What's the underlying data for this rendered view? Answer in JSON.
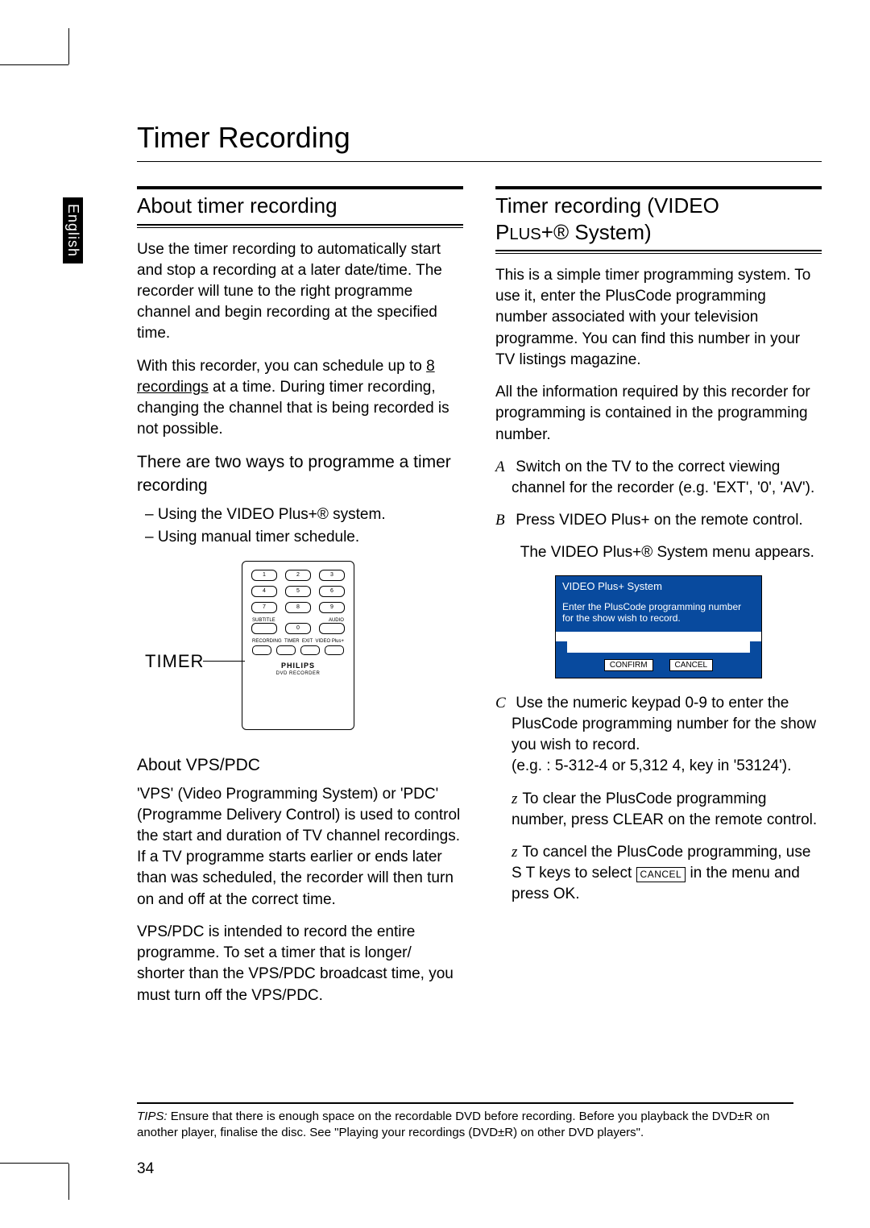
{
  "language_tab": "English",
  "page_title": "Timer Recording",
  "left": {
    "h_about": "About timer recording",
    "p1": "Use the timer recording to automatically start and stop a recording at a later date/time. The recorder will tune to the right programme channel and begin recording at the specified time.",
    "p2a": "With this recorder, you can schedule up to ",
    "p2b_underline": "8 recordings",
    "p2c": " at a time. During timer recording, changing the channel that is being recorded is not possible.",
    "sub_two_ways": "There are two ways to programme a timer recording",
    "way1": "Using the VIDEO Plus+® system.",
    "way2": "Using manual timer schedule.",
    "timer_label": "TIMER",
    "sub_vps": "About  VPS/PDC",
    "vps_p1": "'VPS' (Video Programming System) or 'PDC' (Programme Delivery Control) is used to control the start and duration of TV channel recordings.  If a TV programme starts earlier or ends later than was scheduled, the recorder will then turn on and off at the correct time.",
    "vps_p2": "VPS/PDC is intended to record the entire programme. To set a timer that is longer/ shorter than the VPS/PDC broadcast time, you must turn off the VPS/PDC.",
    "remote": {
      "keys": [
        "1",
        "2",
        "3",
        "4",
        "5",
        "6",
        "7",
        "8",
        "9"
      ],
      "mid_label_subtitle": "SUBTITLE",
      "mid_key": "0",
      "mid_label_audio": "AUDIO",
      "row_labels": [
        "RECORDING",
        "TIMER",
        "EXIT",
        "VIDEO Plus+"
      ],
      "brand": "PHILIPS",
      "sub": "DVD RECORDER"
    }
  },
  "right": {
    "h_timer": "Timer recording (VIDEO PLUS+® System)",
    "p1": "This is a simple timer programming system. To use it, enter the PlusCode programming number associated with your television programme. You can find this number in your TV listings magazine.",
    "p2": "All the information required by this recorder for programming is contained in the programming number.",
    "stepA": "Switch on the TV to the correct viewing channel for the recorder (e.g. 'EXT', '0', 'AV').",
    "stepB": "Press VIDEO Plus+ on the remote control.",
    "stepB_note": "The VIDEO Plus+® System menu appears.",
    "menu": {
      "title": "VIDEO Plus+ System",
      "body": "Enter the PlusCode programming number for the show wish to record.",
      "confirm": "CONFIRM",
      "cancel": "CANCEL"
    },
    "stepC_a": "Use the ",
    "stepC_keypad": "numeric keypad 0-9",
    "stepC_b": " to enter the PlusCode programming number for the show you wish to record.",
    "stepC_eg": "(e.g. : 5-312-4 or 5,312 4, key in '53124').",
    "noteClear_a": "To clear the PlusCode programming number, press ",
    "noteClear_b": "CLEAR",
    "noteClear_c": " on the remote control.",
    "noteCancel_a": "To cancel the PlusCode programming, use  S T  keys to select ",
    "noteCancel_box": "CANCEL",
    "noteCancel_b": " in the menu and press ",
    "noteCancel_ok": "OK",
    "noteCancel_c": "."
  },
  "tips_label": "TIPS:",
  "tips_text": "Ensure that there is enough space on the recordable DVD before recording. Before you playback the DVD±R on another player, finalise the disc. See \"Playing your recordings (DVD±R) on other DVD players\".",
  "page_number": "34"
}
